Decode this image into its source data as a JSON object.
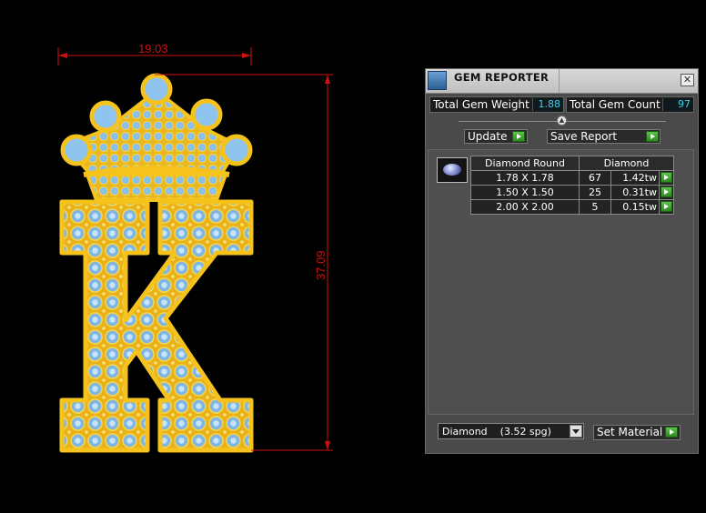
{
  "drawing": {
    "width_dimension": "19.03",
    "height_dimension": "37.09",
    "colors": {
      "gold": "#f6c31d",
      "stone": "#8fc4ee",
      "dimension_line": "#d01010"
    }
  },
  "panel": {
    "title": "GEM REPORTER",
    "close_symbol": "✕",
    "total_weight_label": "Total Gem Weight",
    "total_weight_value": "1.88",
    "total_count_label": "Total Gem Count",
    "total_count_value": "97",
    "update_label": "Update",
    "save_report_label": "Save Report",
    "table": {
      "header_shape": "Diamond Round",
      "header_material": "Diamond",
      "rows": [
        {
          "size": "1.78 X 1.78",
          "count": "67",
          "weight": "1.42tw"
        },
        {
          "size": "1.50 X 1.50",
          "count": "25",
          "weight": "0.31tw"
        },
        {
          "size": "2.00 X 2.00",
          "count": "5",
          "weight": "0.15tw"
        }
      ]
    },
    "material_select_value": "Diamond    (3.52 spg)",
    "set_material_label": "Set Material",
    "colors": {
      "value_text": "#3fd0e6",
      "play_green": "#3fa830"
    }
  }
}
